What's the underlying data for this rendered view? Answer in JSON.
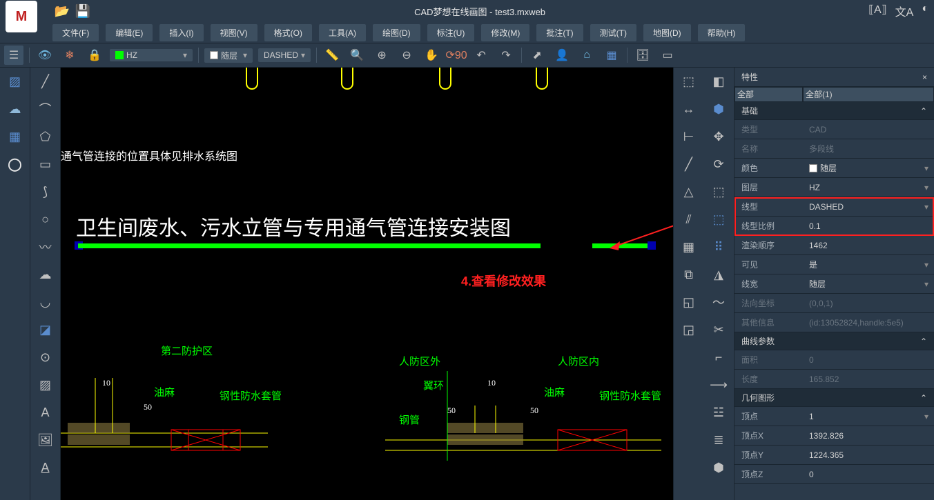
{
  "app": {
    "title": "CAD梦想在线画图 - test3.mxweb",
    "logo": "M"
  },
  "menu": [
    "文件(F)",
    "编辑(E)",
    "插入(I)",
    "视图(V)",
    "格式(O)",
    "工具(A)",
    "绘图(D)",
    "标注(U)",
    "修改(M)",
    "批注(T)",
    "测试(T)",
    "地图(D)",
    "帮助(H)"
  ],
  "layerCombo": {
    "name": "HZ",
    "bylayer": "随层",
    "linetype": "DASHED"
  },
  "canvas": {
    "note": "通气管连接的位置具体见排水系统图",
    "bigTitle": "卫生间废水、污水立管与专用通气管连接安装图",
    "redText": "4.查看修改效果",
    "labels": {
      "zone2": "第二防护区",
      "oil": "油麻",
      "steel": "钢性防水套管",
      "outZone": "人防区外",
      "inZone": "人防区内",
      "wing": "翼环",
      "pipe": "钢管",
      "d10a": "10",
      "d50a": "50",
      "d10b": "10",
      "d50b": "50",
      "d50c": "50"
    }
  },
  "props": {
    "title": "特性",
    "selAll": "全部",
    "selAll2": "全部(1)",
    "secBase": "基础",
    "type_k": "类型",
    "type_v": "CAD",
    "name_k": "名称",
    "name_v": "多段线",
    "color_k": "颜色",
    "color_v": "随层",
    "layer_k": "图层",
    "layer_v": "HZ",
    "ltype_k": "线型",
    "ltype_v": "DASHED",
    "lscale_k": "线型比例",
    "lscale_v": "0.1",
    "render_k": "渲染顺序",
    "render_v": "1462",
    "visible_k": "可见",
    "visible_v": "是",
    "lwidth_k": "线宽",
    "lwidth_v": "随层",
    "normal_k": "法向坐标",
    "normal_v": "(0,0,1)",
    "other_k": "其他信息",
    "other_v": "(id:13052824,handle:5e5)",
    "secCurve": "曲线参数",
    "area_k": "面积",
    "area_v": "0",
    "len_k": "长度",
    "len_v": "165.852",
    "secGeom": "几何图形",
    "vert_k": "顶点",
    "vert_v": "1",
    "vx_k": "顶点X",
    "vx_v": "1392.826",
    "vy_k": "顶点Y",
    "vy_v": "1224.365",
    "vz_k": "顶点Z",
    "vz_v": "0"
  }
}
